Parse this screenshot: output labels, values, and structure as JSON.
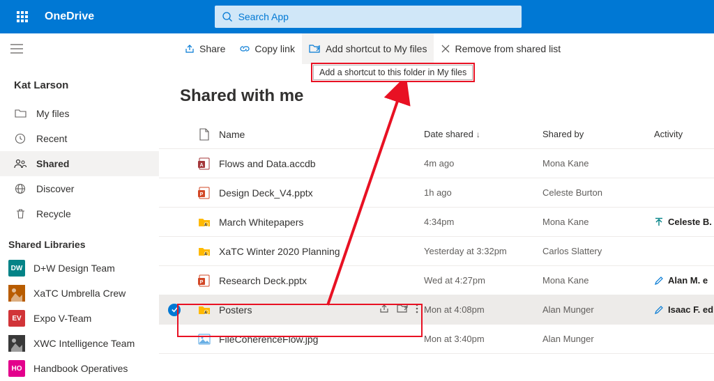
{
  "header": {
    "product": "OneDrive",
    "search_placeholder": "Search App"
  },
  "toolbar": {
    "share": "Share",
    "copy_link": "Copy link",
    "add_shortcut": "Add shortcut to My files",
    "remove_shared": "Remove from shared list"
  },
  "tooltip": "Add a shortcut to this folder in My files",
  "sidebar": {
    "user": "Kat Larson",
    "nav": {
      "my_files": "My files",
      "recent": "Recent",
      "shared": "Shared",
      "discover": "Discover",
      "recycle": "Recycle"
    },
    "libraries_header": "Shared Libraries",
    "libraries": [
      {
        "abbr": "DW",
        "label": "D+W Design Team",
        "color": "#038387"
      },
      {
        "abbr": "",
        "label": "XaTC Umbrella Crew",
        "color": "#b85c00",
        "img": true
      },
      {
        "abbr": "EV",
        "label": "Expo V-Team",
        "color": "#d13438"
      },
      {
        "abbr": "",
        "label": "XWC Intelligence Team",
        "color": "#393939",
        "img": true
      },
      {
        "abbr": "HO",
        "label": "Handbook Operatives",
        "color": "#e3008c"
      }
    ]
  },
  "page": {
    "title": "Shared with me"
  },
  "table": {
    "columns": {
      "name": "Name",
      "date": "Date shared",
      "shared_by": "Shared by",
      "activity": "Activity"
    },
    "rows": [
      {
        "type": "access",
        "name": "Flows and Data.accdb",
        "date": "4m ago",
        "shared_by": "Mona Kane",
        "activity": ""
      },
      {
        "type": "pptx",
        "name": "Design Deck_V4.pptx",
        "date": "1h ago",
        "shared_by": "Celeste Burton",
        "activity": ""
      },
      {
        "type": "folder-shared",
        "name": "March Whitepapers",
        "date": "4:34pm",
        "shared_by": "Mona Kane",
        "activity": "Celeste B.",
        "activity_icon": "open"
      },
      {
        "type": "folder-shared",
        "name": "XaTC Winter 2020 Planning",
        "date": "Yesterday at 3:32pm",
        "shared_by": "Carlos Slattery",
        "activity": ""
      },
      {
        "type": "pptx",
        "name": "Research Deck.pptx",
        "date": "Wed at 4:27pm",
        "shared_by": "Mona Kane",
        "activity": "Alan M. e",
        "activity_icon": "edit"
      },
      {
        "type": "folder-shared",
        "name": "Posters",
        "date": "Mon at 4:08pm",
        "shared_by": "Alan Munger",
        "activity": "Isaac F. ed",
        "activity_icon": "edit",
        "selected": true
      },
      {
        "type": "image",
        "name": "FileCoherenceFlow.jpg",
        "date": "Mon at 3:40pm",
        "shared_by": "Alan Munger",
        "activity": ""
      }
    ]
  }
}
